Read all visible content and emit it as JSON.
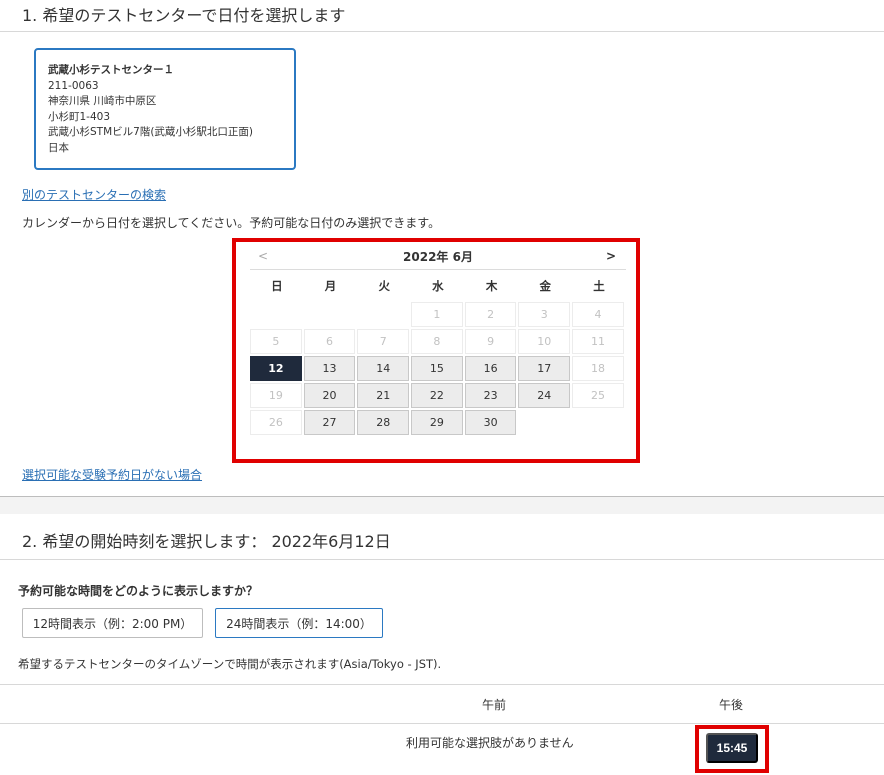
{
  "step1": {
    "title": "1. 希望のテストセンターで日付を選択します",
    "center": {
      "name": "武蔵小杉テストセンター１",
      "postal": "211-0063",
      "address1": "神奈川県 川崎市中原区",
      "address2": "小杉町1-403",
      "address3": "武蔵小杉STMビル7階(武蔵小杉駅北口正面)",
      "country": "日本"
    },
    "search_other_link": "別のテストセンターの検索",
    "instruction": "カレンダーから日付を選択してください。予約可能な日付のみ選択できます。",
    "no_date_link": "選択可能な受験予約日がない場合"
  },
  "calendar": {
    "prev": "<",
    "next": ">",
    "month_label": "2022年 6月",
    "weekdays": [
      "日",
      "月",
      "火",
      "水",
      "木",
      "金",
      "土"
    ],
    "leading_blanks": 3,
    "days_in_month": 30,
    "available_days": [
      13,
      14,
      15,
      16,
      17,
      20,
      21,
      22,
      23,
      24,
      27,
      28,
      29,
      30
    ],
    "selected_day": 12
  },
  "step2": {
    "title": "2. 希望の開始時刻を選択します： 2022年6月12日",
    "question": "予約可能な時間をどのように表示しますか？",
    "format_12h": "12時間表示（例：2:00 PM）",
    "format_24h": "24時間表示（例：14:00）",
    "timezone_note": "希望するテストセンターのタイムゾーンで時間が表示されます(Asia/Tokyo - JST).",
    "col_am": "午前",
    "col_pm": "午後",
    "am_empty": "利用可能な選択肢がありません",
    "pm_slot": "15:45"
  },
  "colors": {
    "accent_blue": "#2b79c2",
    "selected_dark": "#1f2a3c",
    "highlight_red": "#e00000",
    "link": "#2a6fb4"
  }
}
